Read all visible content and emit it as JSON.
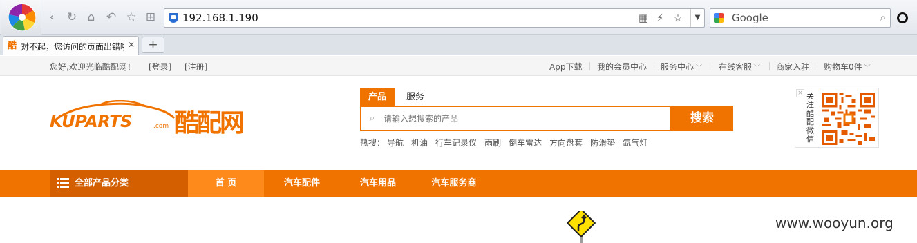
{
  "browser": {
    "address_url": "192.168.1.190",
    "search_engine": "Google",
    "tab_title": "对不起，您访问的页面出错啦",
    "new_tab_label": "+",
    "icons": [
      "back-icon",
      "refresh-icon",
      "home-icon",
      "undo-icon",
      "star-icon",
      "grid-icon",
      "qr-icon",
      "lightning-icon",
      "bookmark-star-icon",
      "search-icon"
    ]
  },
  "topbar": {
    "welcome": "您好,欢迎光临酷配网！",
    "login": "[登录]",
    "register": "[注册]",
    "links": [
      "App下载",
      "我的会员中心",
      "服务中心",
      "在线客服",
      "商家入驻",
      "购物车0件"
    ]
  },
  "logo": {
    "en": "KUPARTS",
    "com": ".com",
    "cn": "酷配网"
  },
  "search": {
    "tabs": [
      "产品",
      "服务"
    ],
    "placeholder": "请输入想搜索的产品",
    "button": "搜索",
    "hot_label": "热搜：",
    "hot_terms": [
      "导航",
      "机油",
      "行车记录仪",
      "雨刷",
      "倒车雷达",
      "方向盘套",
      "防滑垫",
      "氙气灯"
    ]
  },
  "qr": {
    "label": "关注酷配微信",
    "close": "×"
  },
  "nav": {
    "all_categories": "全部产品分类",
    "items": [
      "首 页",
      "汽车配件",
      "汽车用品",
      "汽车服务商"
    ]
  },
  "watermark": "www.wooyun.org",
  "colors": {
    "brand_orange": "#f07300",
    "dark_orange": "#d35f00"
  }
}
